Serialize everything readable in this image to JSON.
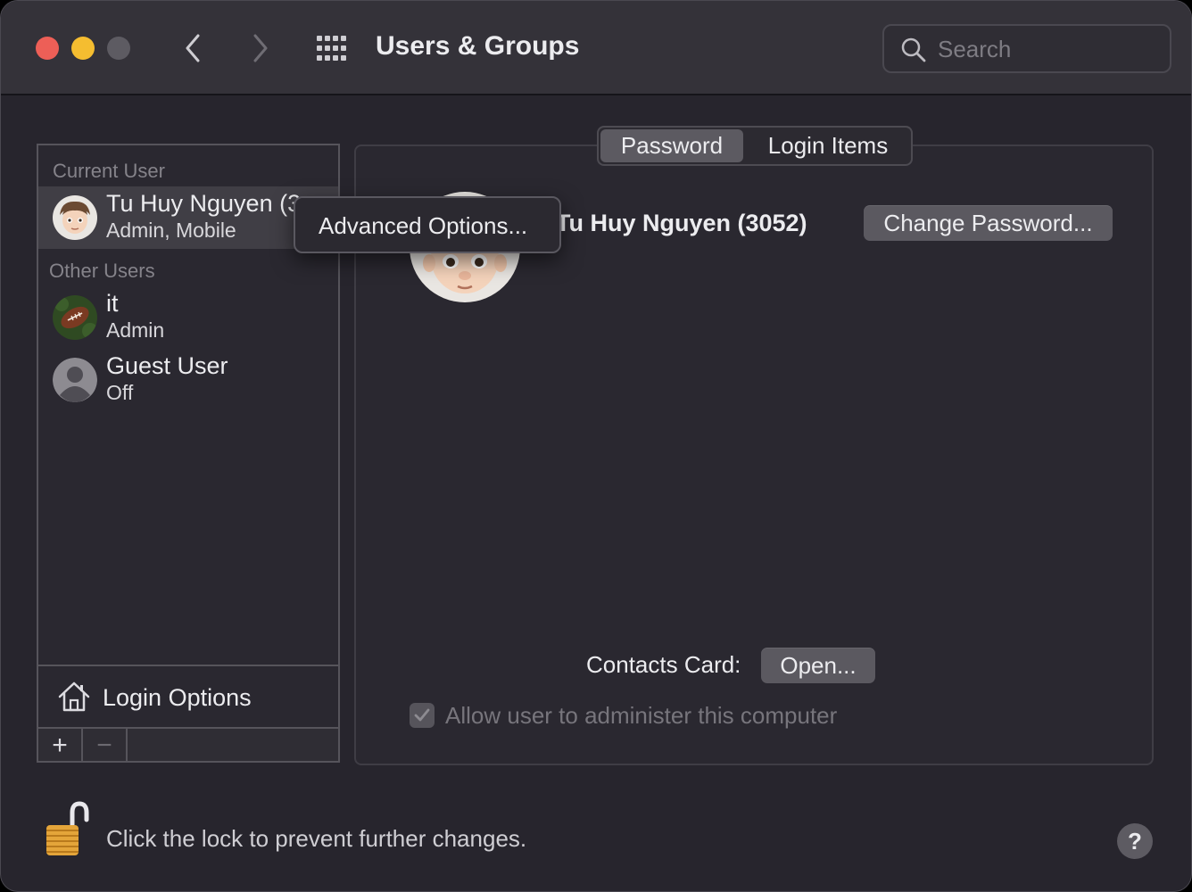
{
  "window": {
    "title": "Users & Groups",
    "search_placeholder": "Search"
  },
  "sidebar": {
    "current_user_header": "Current User",
    "other_users_header": "Other Users",
    "current_user": {
      "name": "Tu Huy Nguyen (3",
      "sub": "Admin, Mobile",
      "icon": "memoji-avatar"
    },
    "other_users": [
      {
        "name": "it",
        "sub": "Admin",
        "icon": "football-avatar"
      },
      {
        "name": "Guest User",
        "sub": "Off",
        "icon": "generic-user-avatar"
      }
    ],
    "login_options_label": "Login Options",
    "add_label": "+",
    "remove_label": "−"
  },
  "context_menu": {
    "items": [
      "Advanced Options..."
    ]
  },
  "main": {
    "tabs": [
      {
        "label": "Password",
        "selected": true
      },
      {
        "label": "Login Items",
        "selected": false
      }
    ],
    "full_name": "Tu Huy Nguyen (3052)",
    "change_password_label": "Change Password...",
    "contacts_card_label": "Contacts Card:",
    "open_label": "Open...",
    "admin_checkbox_label": "Allow user to administer this computer",
    "admin_checked": true
  },
  "footer": {
    "lock_text": "Click the lock to prevent further changes.",
    "help_label": "?"
  },
  "colors": {
    "close": "#ed5f57",
    "minimize": "#f5bd30",
    "window_bg": "#27252d",
    "button_bg": "#5b5960"
  }
}
